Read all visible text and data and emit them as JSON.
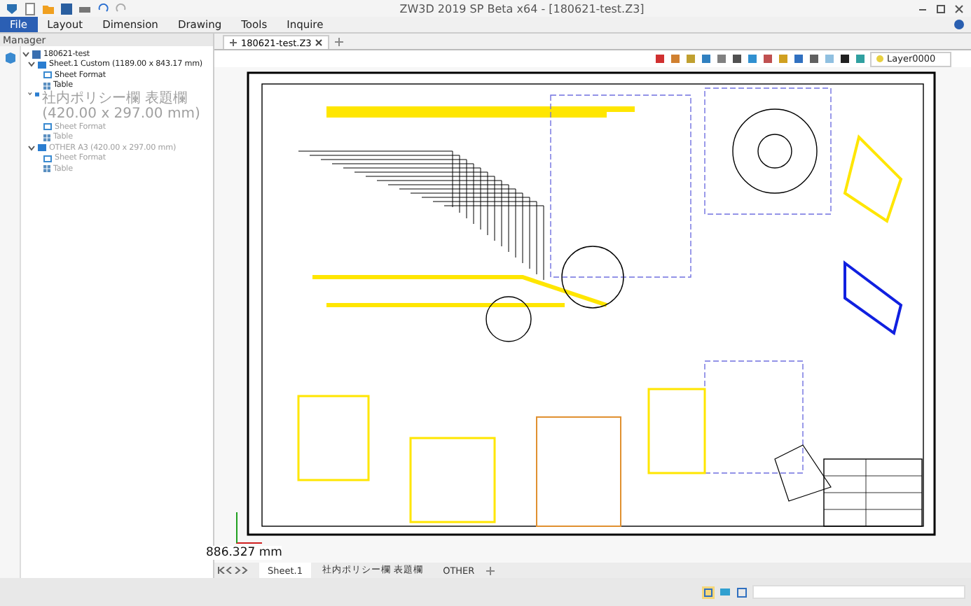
{
  "window": {
    "title": "ZW3D 2019 SP Beta x64 - [180621-test.Z3]"
  },
  "menu": [
    {
      "label": "File",
      "selected": true
    },
    {
      "label": "Layout",
      "selected": false
    },
    {
      "label": "Dimension",
      "selected": false
    },
    {
      "label": "Drawing",
      "selected": false
    },
    {
      "label": "Tools",
      "selected": false
    },
    {
      "label": "Inquire",
      "selected": false
    }
  ],
  "manager": {
    "title": "Manager",
    "tree": [
      {
        "label": "180621-test",
        "kind": "document",
        "active": true,
        "children": [
          {
            "label": "Sheet.1 Custom (1189.00 x 843.17 mm)",
            "kind": "sheet",
            "active": true,
            "children": [
              {
                "label": "Sheet Format",
                "kind": "format",
                "active": true
              },
              {
                "label": "Table",
                "kind": "table",
                "active": true
              }
            ]
          },
          {
            "label": "社内ポリシー欄 表題欄 (420.00 x 297.00 mm)",
            "kind": "sheet",
            "active": false,
            "children": [
              {
                "label": "Sheet Format",
                "kind": "format",
                "active": false
              },
              {
                "label": "Table",
                "kind": "table",
                "active": false
              }
            ]
          },
          {
            "label": "OTHER A3 (420.00 x 297.00 mm)",
            "kind": "sheet",
            "active": false,
            "children": [
              {
                "label": "Sheet Format",
                "kind": "format",
                "active": false
              },
              {
                "label": "Table",
                "kind": "table",
                "active": false
              }
            ]
          }
        ]
      }
    ]
  },
  "document_tab": {
    "label": "180621-test.Z3"
  },
  "layer": {
    "value": "Layer0000"
  },
  "coordinate": "886.327 mm",
  "sheet_tabs": [
    {
      "label": "Sheet.1",
      "selected": true
    },
    {
      "label": "社内ポリシー欄 表題欄",
      "selected": false
    },
    {
      "label": "OTHER",
      "selected": false
    }
  ]
}
